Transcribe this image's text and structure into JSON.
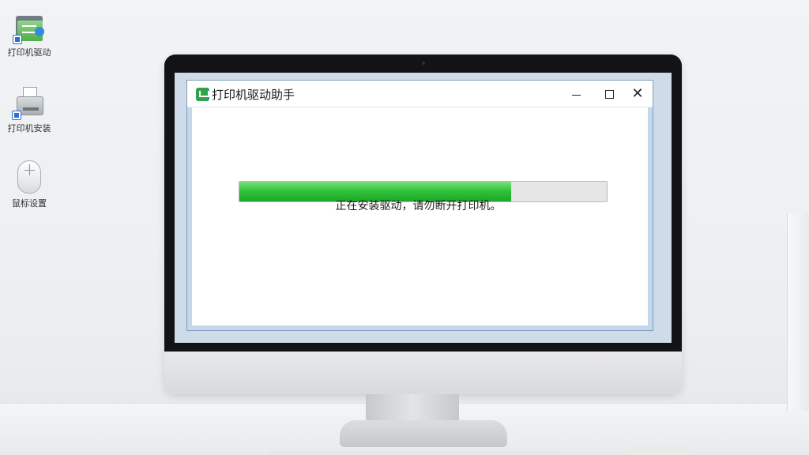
{
  "desktop": {
    "icons": [
      {
        "label": "打印机驱动",
        "icon": "printer-driver-folder-icon"
      },
      {
        "label": "打印机安装",
        "icon": "printer-icon"
      },
      {
        "label": "鼠标设置",
        "icon": "mouse-icon"
      }
    ]
  },
  "window": {
    "title": "打印机驱动助手",
    "controls": {
      "minimize": "minimize-icon",
      "maximize": "maximize-icon",
      "close": "✕"
    },
    "progress": {
      "percent": 74,
      "color": "#33c23c"
    },
    "status": "正在安装驱动，请勿断开打印机。"
  }
}
